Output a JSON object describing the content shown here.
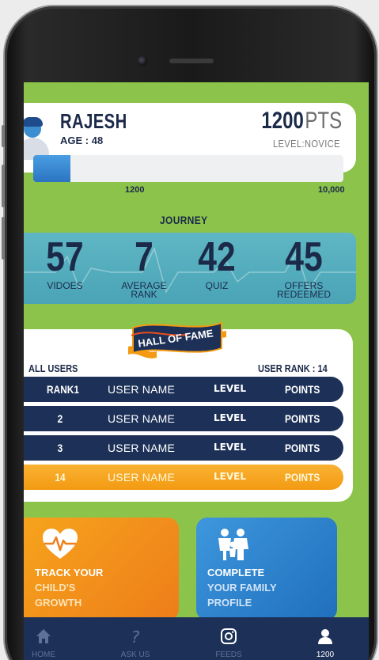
{
  "profile": {
    "name": "RAJESH",
    "age": "AGE : 48",
    "points_value": "1200",
    "points_unit": "PTS",
    "level": "LEVEL:NOVICE",
    "progress_fraction": 0.12,
    "progress_min_label": "1200",
    "progress_max_label": "10,000"
  },
  "journey": {
    "title": "JOURNEY",
    "stats": [
      {
        "value": "57",
        "label_line1": "VIDOES",
        "label_line2": ""
      },
      {
        "value": "7",
        "label_line1": "AVERAGE",
        "label_line2": "RANK"
      },
      {
        "value": "42",
        "label_line1": "QUIZ",
        "label_line2": ""
      },
      {
        "value": "45",
        "label_line1": "OFFERS",
        "label_line2": "REDEEMED"
      }
    ]
  },
  "hall_of_fame": {
    "banner": "HALL OF FAME",
    "all_users_label": "ALL USERS",
    "user_rank_label": "USER RANK : 14",
    "rows": [
      {
        "rank": "RANK1",
        "user": "USER NAME",
        "level": "LEVEL",
        "points": "POINTS",
        "highlight": false
      },
      {
        "rank": "2",
        "user": "USER NAME",
        "level": "LEVEL",
        "points": "POINTS",
        "highlight": false
      },
      {
        "rank": "3",
        "user": "USER NAME",
        "level": "LEVEL",
        "points": "POINTS",
        "highlight": false
      },
      {
        "rank": "14",
        "user": "USER NAME",
        "level": "LEVEL",
        "points": "POINTS",
        "highlight": true
      }
    ]
  },
  "cards": {
    "track": {
      "line1": "TRACK YOUR",
      "line2": "CHILD'S",
      "line3": "GROWTH",
      "icon": "heart-pulse-icon"
    },
    "family": {
      "line1": "COMPLETE",
      "line2": "YOUR FAMILY",
      "line3": "PROFILE",
      "icon": "family-icon"
    }
  },
  "nav": {
    "home": "HOME",
    "ask": "ASK US",
    "feeds": "FEEDS",
    "profile": "1200"
  },
  "colors": {
    "background_green": "#8cc34a",
    "navy": "#1d3158",
    "orange": "#f39a12",
    "blue": "#2b74c2",
    "teal": "#4aa4b6"
  }
}
